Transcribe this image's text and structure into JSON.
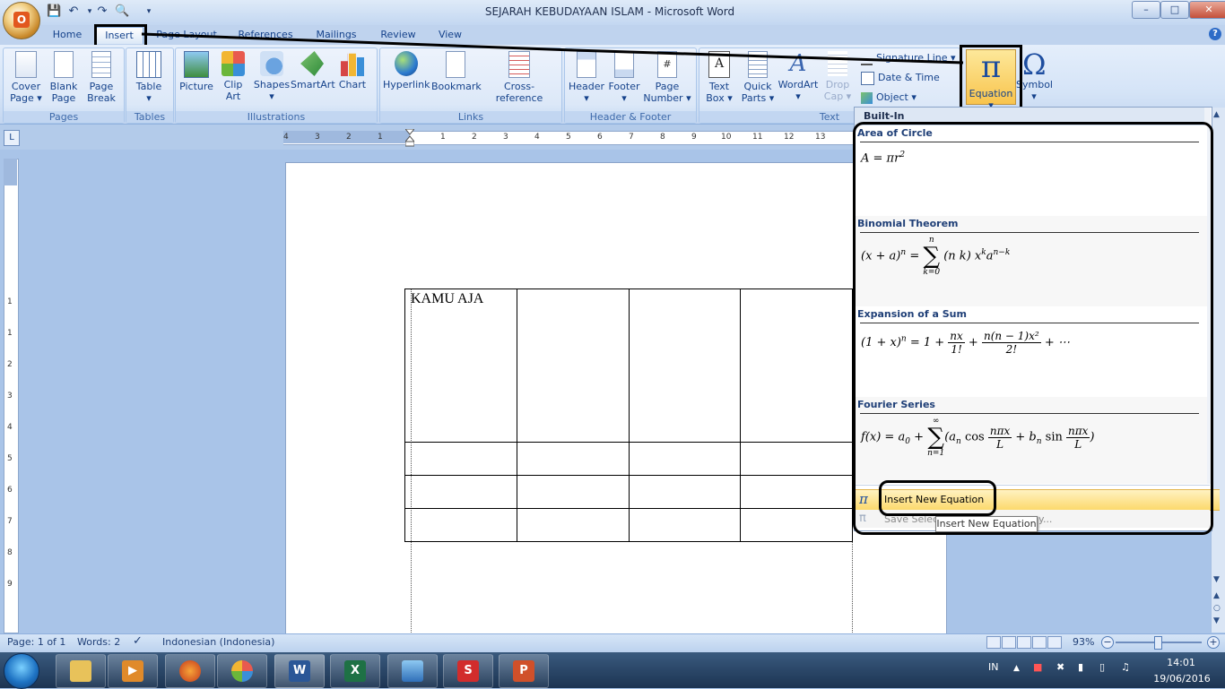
{
  "window": {
    "title": "SEJARAH KEBUDAYAAN ISLAM - Microsoft Word",
    "minimize": "–",
    "maximize": "□",
    "close": "✕"
  },
  "qat": {
    "save_icon": "save-icon",
    "undo_icon": "undo-icon",
    "redo_icon": "redo-icon",
    "preview_icon": "print-preview-icon",
    "dropdown_icon": "dropdown-icon"
  },
  "tabs": [
    "Home",
    "Insert",
    "Page Layout",
    "References",
    "Mailings",
    "Review",
    "View"
  ],
  "help": "?",
  "ribbon": {
    "groups": {
      "pages": "Pages",
      "tables": "Tables",
      "illustrations": "Illustrations",
      "links": "Links",
      "header_footer": "Header & Footer",
      "text": "Text"
    },
    "buttons": {
      "cover_page_1": "Cover",
      "cover_page_2": "Page ▾",
      "blank_page_1": "Blank",
      "blank_page_2": "Page",
      "page_break_1": "Page",
      "page_break_2": "Break",
      "table_1": "Table",
      "table_2": "▾",
      "picture": "Picture",
      "clip_art_1": "Clip",
      "clip_art_2": "Art",
      "shapes_1": "Shapes",
      "shapes_2": "▾",
      "smartart": "SmartArt",
      "chart": "Chart",
      "hyperlink": "Hyperlink",
      "bookmark": "Bookmark",
      "cross_reference": "Cross-reference",
      "header_1": "Header",
      "header_2": "▾",
      "footer_1": "Footer",
      "footer_2": "▾",
      "page_number_1": "Page",
      "page_number_2": "Number ▾",
      "text_box_1": "Text",
      "text_box_2": "Box ▾",
      "quick_parts_1": "Quick",
      "quick_parts_2": "Parts ▾",
      "wordart_1": "WordArt",
      "wordart_2": "▾",
      "drop_cap_1": "Drop",
      "drop_cap_2": "Cap ▾",
      "signature_line": "Signature Line ▾",
      "date_time": "Date & Time",
      "object": "Object ▾",
      "equation_symbol": "π",
      "equation_1": "Equation",
      "equation_2": "▾",
      "symbol_glyph": "Ω",
      "symbol_1": "Symbol",
      "symbol_2": "▾"
    }
  },
  "ruler": {
    "corner": "L",
    "numbers": [
      "4",
      "3",
      "2",
      "1",
      "1",
      "2",
      "3",
      "4",
      "5",
      "6",
      "7",
      "8",
      "9",
      "10",
      "11",
      "12",
      "13"
    ],
    "vnumbers": [
      "1",
      "1",
      "2",
      "3",
      "4",
      "5",
      "6",
      "7",
      "8",
      "9"
    ]
  },
  "document": {
    "table": [
      [
        "KAMU AJA",
        "",
        "",
        ""
      ],
      [
        "",
        "",
        "",
        ""
      ],
      [
        "",
        "",
        "",
        ""
      ],
      [
        "",
        "",
        "",
        ""
      ]
    ]
  },
  "equation_gallery": {
    "header": "Built-In",
    "items": [
      {
        "title": "Area of Circle"
      },
      {
        "title": "Binomial Theorem"
      },
      {
        "title": "Expansion of a Sum"
      },
      {
        "title": "Fourier Series"
      }
    ],
    "eq": {
      "area": "A = πr",
      "area_sup": "2",
      "binom_lhs": "(x + a)",
      "binom_n": "n",
      "binom_eq": " = ",
      "sum_sym": "∑",
      "sum_top": "n",
      "sum_bottom": "k=0",
      "binom_choose": "(n k)",
      "binom_rest": "x",
      "binom_k": "k",
      "binom_a": "a",
      "binom_nk": "n−k",
      "exp_lhs": "(1 + x)",
      "exp_n": "n",
      "exp_eq": " = 1 + ",
      "exp_f1_n": "nx",
      "exp_f1_d": "1!",
      "exp_plus": " + ",
      "exp_f2_n": "n(n − 1)x²",
      "exp_f2_d": "2!",
      "exp_tail": " + ⋯",
      "four_lhs": "f(x) = a",
      "four_0": "0",
      "four_plus": " + ",
      "four_sum_top": "∞",
      "four_sum_bottom": "n=1",
      "four_open": "(a",
      "four_n": "n",
      "four_cos": " cos ",
      "four_f_n": "nπx",
      "four_f_d": "L",
      "four_plus2": " + b",
      "four_sin": " sin ",
      "four_close": ")"
    },
    "insert_new": "Insert New Equation",
    "save_selection": "Save Select",
    "save_selection_tail": "y...",
    "tooltip": "Insert New Equation"
  },
  "status": {
    "page": "Page: 1 of 1",
    "words": "Words: 2",
    "language": "Indonesian (Indonesia)",
    "zoom": "93%",
    "zoom_minus": "−",
    "zoom_plus": "+"
  },
  "taskbar": {
    "lang": "IN",
    "time": "14:01",
    "date": "19/06/2016",
    "word_letter": "W",
    "excel_letter": "X"
  },
  "colors": {
    "accent": "#15428b",
    "highlight": "#f8c44d",
    "word": "#2b5797",
    "excel": "#1e7145"
  }
}
